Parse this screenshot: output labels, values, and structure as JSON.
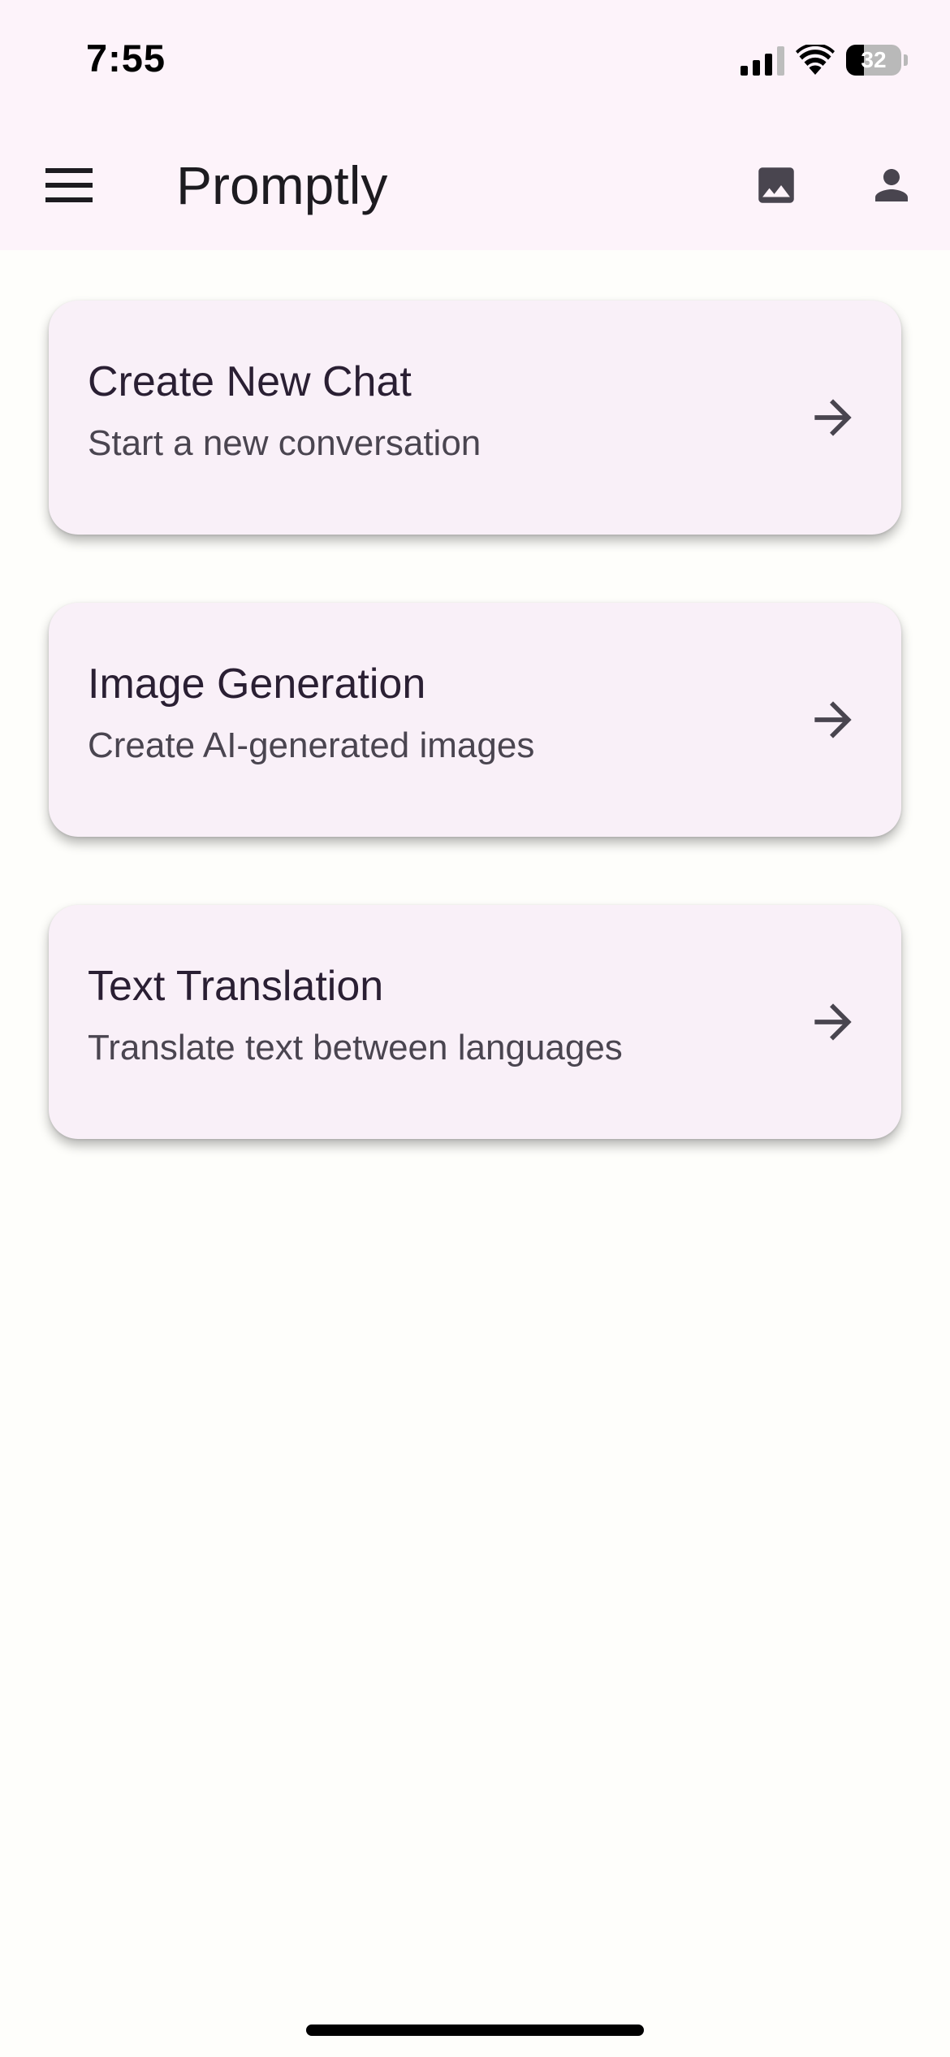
{
  "status_bar": {
    "time": "7:55",
    "battery": "32",
    "battery_level_percent": 32
  },
  "app_bar": {
    "title": "Promptly",
    "menu_icon": "menu-icon",
    "image_icon": "image-icon",
    "account_icon": "account-icon"
  },
  "cards": [
    {
      "title": "Create New Chat",
      "subtitle": "Start a new conversation",
      "icon": "arrow-right-icon"
    },
    {
      "title": "Image Generation",
      "subtitle": "Create AI-generated images",
      "icon": "arrow-right-icon"
    },
    {
      "title": "Text Translation",
      "subtitle": "Translate text between languages",
      "icon": "arrow-right-icon"
    }
  ],
  "colors": {
    "background": "#fefefb",
    "app_bar_background": "#fdf3fa",
    "card_background": "#f9f0f8",
    "primary_text": "#2a1f33",
    "secondary_text": "#4a4550",
    "icon": "#49454f"
  }
}
